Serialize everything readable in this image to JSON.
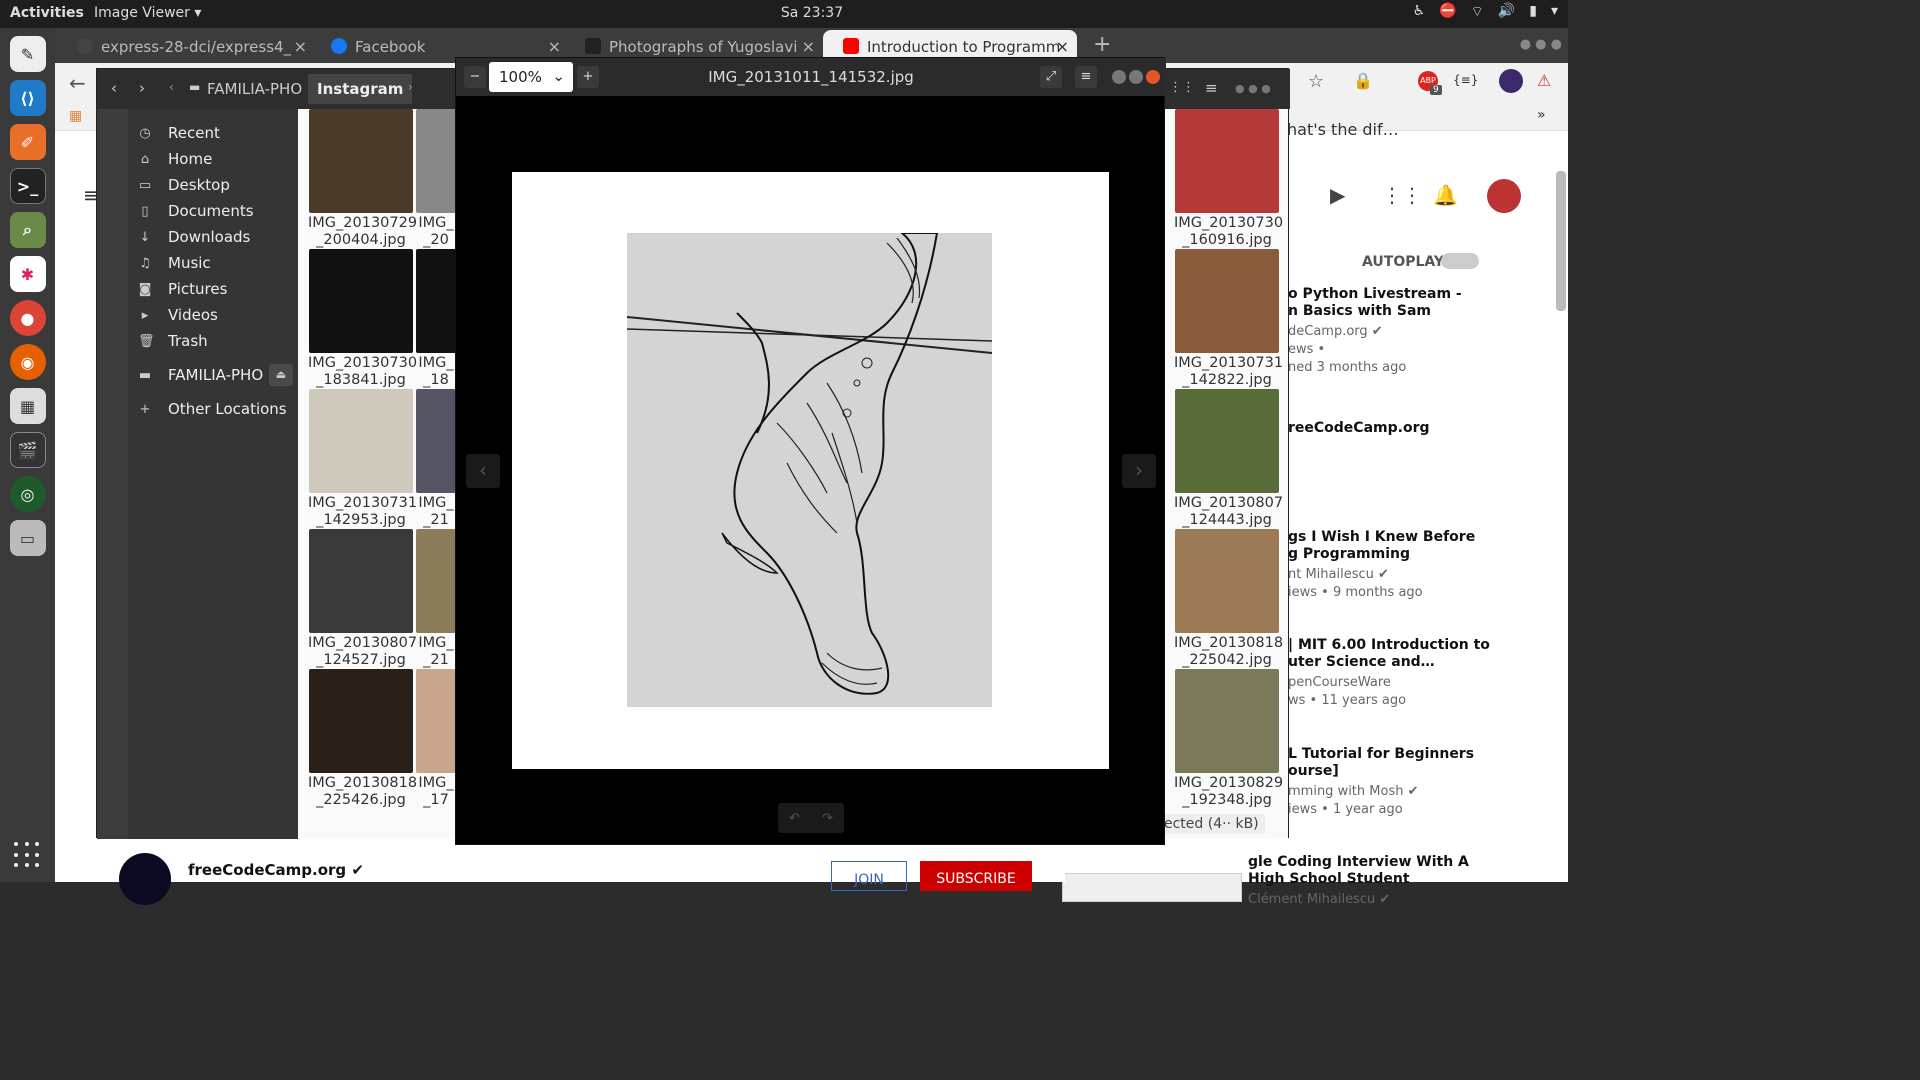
{
  "topbar": {
    "activities": "Activities",
    "app_menu": "Image Viewer ▾",
    "clock": "Sa 23:37"
  },
  "browser": {
    "tabs": [
      {
        "label": "express-28-dci/express4_",
        "close": "×",
        "favicon_color": "#444444"
      },
      {
        "label": "Facebook",
        "close": "×",
        "favicon_color": "#1877f2"
      },
      {
        "label": "Photographs of Yugoslavi",
        "close": "×",
        "favicon_color": "#222222"
      },
      {
        "label": "Introduction to Programm",
        "close": "×",
        "favicon_color": "#ff0000"
      }
    ],
    "new_tab": "+",
    "ext_badge": "9",
    "ext_label": "ABP",
    "ext_code": "{≡}"
  },
  "youtube": {
    "title_partial": "hat's the dif…",
    "autoplay_label": "AUTOPLAY",
    "sidebar_videos": [
      {
        "title": "o Python Livestream -\nn Basics with Sam",
        "meta": "deCamp.org ✔\news •\nned 3 months ago"
      },
      {
        "title": "reeCodeCamp.org",
        "meta": ""
      },
      {
        "title": "gs I Wish I Knew Before\ng Programming",
        "meta": "nt Mihailescu ✔\niews • 9 months ago"
      },
      {
        "title": "| MIT 6.00 Introduction to\nuter Science and…",
        "meta": "penCourseWare\nws • 11 years ago"
      },
      {
        "title": "L Tutorial for Beginners\nourse]",
        "meta": "mming with Mosh ✔\niews • 1 year ago"
      },
      {
        "title": "gle Coding Interview With A\nHigh School Student",
        "meta": "Clément Mihailescu ✔"
      }
    ],
    "channel_name": "freeCodeCamp.org ✔",
    "join_label": "JOIN",
    "subscribe_label": "SUBSCRIBE"
  },
  "files": {
    "path_root": "FAMILIA-PHO",
    "path_current": "Instagram",
    "places": [
      {
        "label": "Recent",
        "icon": "clock-icon"
      },
      {
        "label": "Home",
        "icon": "home-icon"
      },
      {
        "label": "Desktop",
        "icon": "desktop-icon"
      },
      {
        "label": "Documents",
        "icon": "document-icon"
      },
      {
        "label": "Downloads",
        "icon": "download-icon"
      },
      {
        "label": "Music",
        "icon": "music-icon"
      },
      {
        "label": "Pictures",
        "icon": "camera-icon"
      },
      {
        "label": "Videos",
        "icon": "video-icon"
      },
      {
        "label": "Trash",
        "icon": "trash-icon"
      },
      {
        "label": "FAMILIA-PHO",
        "icon": "drive-icon"
      },
      {
        "label": "Other Locations",
        "icon": "plus-icon"
      }
    ],
    "thumbs_left": [
      {
        "line1": "IMG_20130729",
        "line2": "_200404.jpg",
        "color": "#4a3a2a"
      },
      {
        "line1": "IMG_20130730",
        "line2": "_183841.jpg",
        "color": "#111111"
      },
      {
        "line1": "IMG_20130731",
        "line2": "_142953.jpg",
        "color": "#cfc8bd"
      },
      {
        "line1": "IMG_20130807",
        "line2": "_124527.jpg",
        "color": "#3a3a3a"
      },
      {
        "line1": "IMG_20130818",
        "line2": "_225426.jpg",
        "color": "#2b2018"
      }
    ],
    "thumbs_mid": [
      {
        "line1": "IMG_",
        "line2": "_20",
        "color": "#888888"
      },
      {
        "line1": "IMG_",
        "line2": "_18",
        "color": "#111111"
      },
      {
        "line1": "IMG_",
        "line2": "_21",
        "color": "#555566"
      },
      {
        "line1": "IMG_",
        "line2": "_21",
        "color": "#8b7d5a"
      },
      {
        "line1": "IMG_",
        "line2": "_17",
        "color": "#c8a58d"
      }
    ],
    "thumbs_right": [
      {
        "line1": "IMG_20130730",
        "line2": "_160916.jpg",
        "color": "#b53a3a"
      },
      {
        "line1": "IMG_20130731",
        "line2": "_142822.jpg",
        "color": "#8a5b3a"
      },
      {
        "line1": "IMG_20130807",
        "line2": "_124443.jpg",
        "color": "#5a6b3a"
      },
      {
        "line1": "IMG_20130818",
        "line2": "_225042.jpg",
        "color": "#9b7a55"
      },
      {
        "line1": "IMG_20130829",
        "line2": "_192348.jpg",
        "color": "#7a7a5a"
      }
    ],
    "status_partial": "ected (4·· kB)"
  },
  "viewer": {
    "filename": "IMG_20131011_141532.jpg",
    "zoom": "100%",
    "zoom_out": "−",
    "zoom_in": "+",
    "prev": "‹",
    "next": "›",
    "rotate_left": "↶",
    "rotate_right": "↷"
  }
}
